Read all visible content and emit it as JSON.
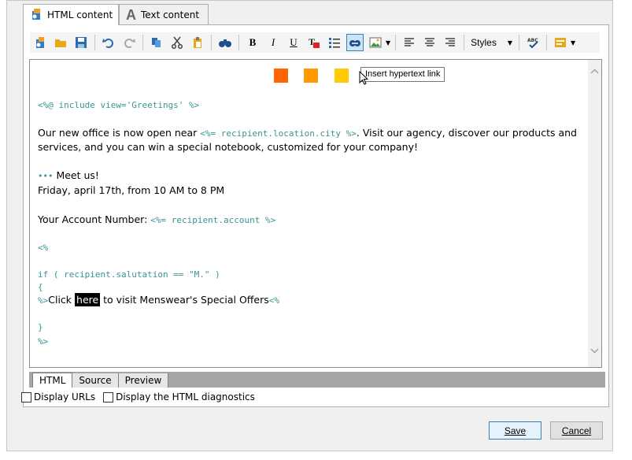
{
  "tabs": [
    {
      "label": "HTML content",
      "active": true
    },
    {
      "label": "Text content",
      "active": false
    }
  ],
  "toolbar": {
    "styles_label": "Styles",
    "tooltip": "Insert hypertext link"
  },
  "swatch_colors": [
    "#ff6600",
    "#ff9900",
    "#ffcc00"
  ],
  "editor": {
    "line1": "<%@ include view='Greetings' %>",
    "line2a": "Our new office is now open near ",
    "line2b": "<%= recipient.location.city %>",
    "line2c": ". Visit our agency, discover our products and",
    "line3": "services, and you can win a special notebook, customized for your company!",
    "bullet": "•••",
    "meet": " Meet us!",
    "date": "Friday, april 17th, from 10 AM to 8 PM",
    "account_label": "Your Account Number: ",
    "account_code": "<%= recipient.account %>",
    "open_tag": "<%",
    "if_line": "if ( recipient.salutation == \"M.\" )",
    "brace_open": " {",
    "click_code_prefix": "%>",
    "click_text": "Click ",
    "here": "here",
    "visit_text": " to visit Menswear's Special Offers",
    "click_code_suffix": "<%",
    "brace_close": " }",
    "close_tag": "%>"
  },
  "bottom_tabs": [
    "HTML",
    "Source",
    "Preview"
  ],
  "options": {
    "display_urls": "Display URLs",
    "html_diagnostics": "Display the HTML diagnostics"
  },
  "buttons": {
    "save": "Save",
    "cancel": "Cancel"
  }
}
